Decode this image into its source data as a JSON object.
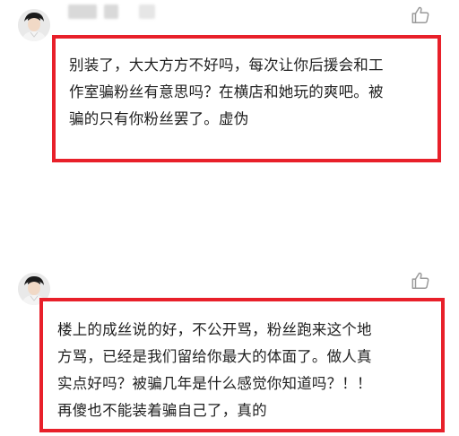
{
  "comments": [
    {
      "text": "别装了，大大方方不好吗，每次让你后援会和工\n作室骗粉丝有意思吗？在横店和她玩的爽吧。被\n骗的只有你粉丝罢了。虚伪"
    },
    {
      "text": "楼上的成丝说的好，不公开骂，粉丝跑来这个地\n方骂，已经是我们留给你最大的体面了。做人真\n实点好吗？被骗几年是什么感觉你知道吗？！！\n再傻也不能装着骗自己了，真的"
    }
  ],
  "icons": {
    "avatar": "avatar-icon",
    "like": "thumbs-up-icon"
  },
  "colors": {
    "highlight_border": "#e8202a",
    "text": "#1f1f1f",
    "like_icon": "#9a9a9a"
  }
}
